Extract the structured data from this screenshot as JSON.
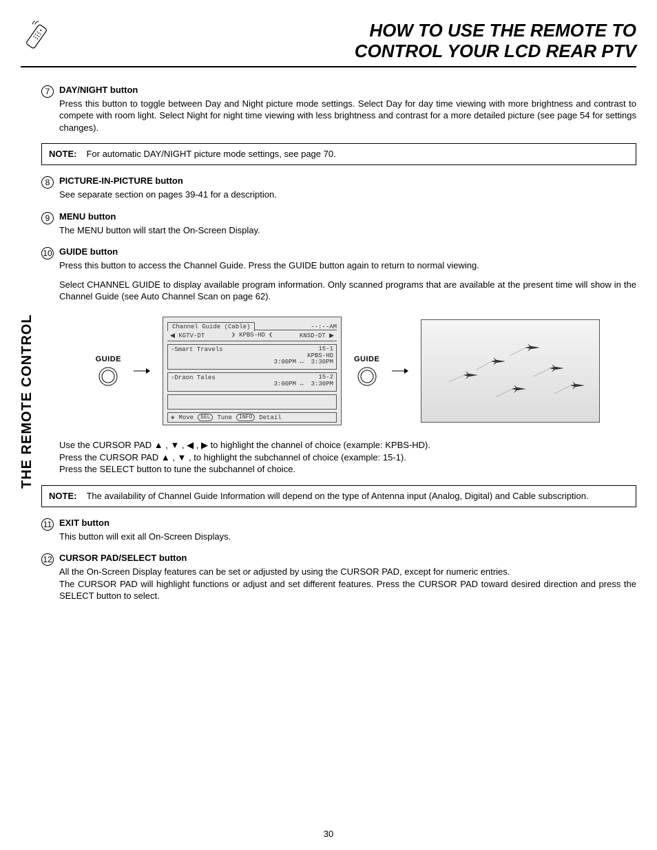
{
  "header": {
    "title_line1": "HOW TO USE THE REMOTE TO",
    "title_line2": "CONTROL YOUR LCD REAR PTV"
  },
  "side_tab": "THE REMOTE CONTROL",
  "items": [
    {
      "num": "7",
      "title": "DAY/NIGHT button",
      "body": "Press this button to toggle between Day and Night picture mode settings.  Select Day for day time viewing with more brightness and contrast to compete with room light.  Select Night for night time viewing with less brightness and contrast for a more detailed picture (see page 54 for settings changes)."
    },
    {
      "num": "8",
      "title": "PICTURE-IN-PICTURE button",
      "body": "See separate section on pages 39-41 for a description."
    },
    {
      "num": "9",
      "title": "MENU button",
      "body": "The MENU button will start the On-Screen Display."
    },
    {
      "num": "10",
      "title": "GUIDE button",
      "body": "Press this button to access the Channel Guide.  Press the GUIDE button again to return to normal viewing.",
      "body2": "Select CHANNEL GUIDE to display available program information.  Only scanned programs that are available at the present time will show in the Channel Guide (see Auto Channel Scan on page 62)."
    },
    {
      "num": "11",
      "title": "EXIT button",
      "body": "This button will exit all On-Screen Displays."
    },
    {
      "num": "12",
      "title": "CURSOR PAD/SELECT button",
      "body": "All the On-Screen Display features can be set or adjusted by using the CURSOR PAD, except for numeric entries.",
      "body2": "The CURSOR PAD will highlight functions or adjust and set different features.  Press the CURSOR PAD toward desired direction and press the SELECT button to select."
    }
  ],
  "note1": {
    "label": "NOTE:",
    "text": "For automatic DAY/NIGHT picture mode settings, see page 70."
  },
  "note2": {
    "label": "NOTE:",
    "text": "The availability of Channel Guide Information will depend on the type of Antenna input (Analog, Digital) and Cable subscription."
  },
  "guide": {
    "button_label": "GUIDE",
    "osd": {
      "title": "Channel Guide (Cable)",
      "time": "--:--AM",
      "channels": {
        "left": "KGTV-DT",
        "mid": "KPBS-HD",
        "right": "KNSD-DT"
      },
      "entries": [
        {
          "left": "Smart Travels",
          "r1": "15-1",
          "r2": "KPBS-HD",
          "r3": "3:00PM",
          "r4": "3:30PM"
        },
        {
          "left": "Draon Tales",
          "r1": "15-2",
          "r2": "",
          "r3": "3:00PM",
          "r4": "3:30PM"
        }
      ],
      "footer": {
        "move": "Move",
        "sel": "SEL",
        "tune": "Tune",
        "info": "INFO",
        "detail": "Detail"
      }
    },
    "instructions": {
      "l1": "Use the CURSOR PAD ▲ , ▼ , ◀ , ▶ to highlight the channel of choice (example: KPBS-HD).",
      "l2": "Press  the CURSOR PAD ▲ , ▼ , to highlight the subchannel of choice (example: 15-1).",
      "l3": "Press the SELECT button to tune the subchannel of choice."
    }
  },
  "page_number": "30"
}
